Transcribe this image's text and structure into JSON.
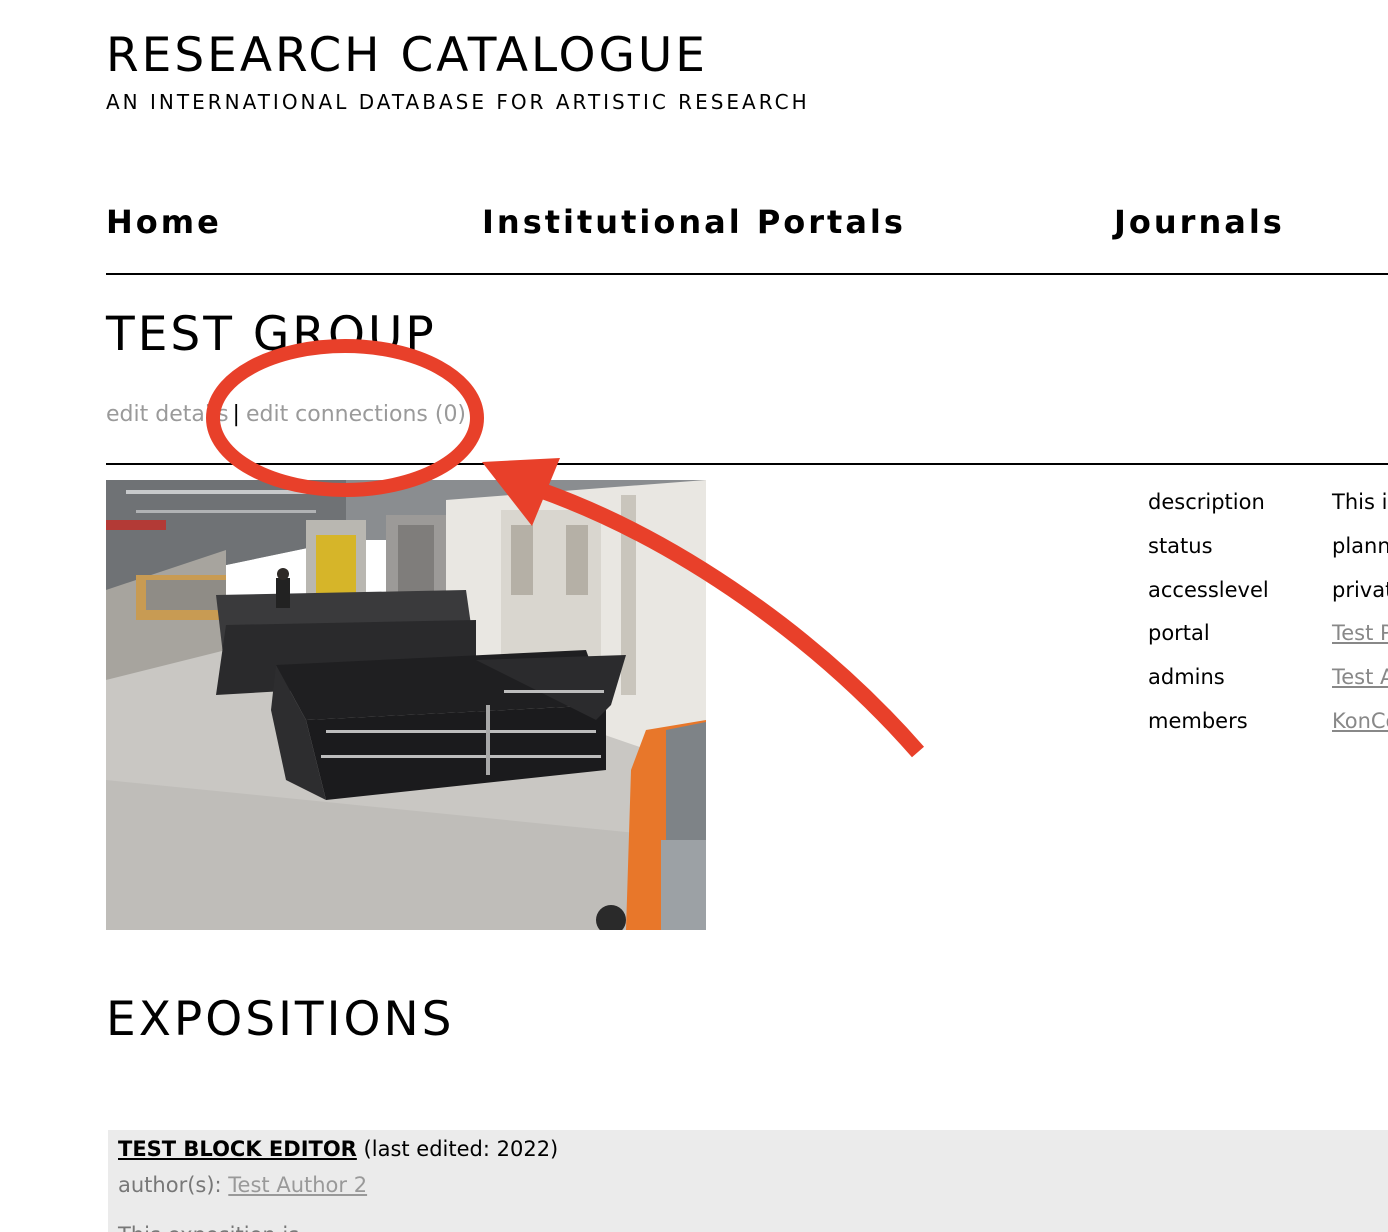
{
  "header": {
    "site_title": "RESEARCH CATALOGUE",
    "site_subtitle": "AN INTERNATIONAL DATABASE FOR ARTISTIC RESEARCH"
  },
  "nav": {
    "items": [
      {
        "label": "Home"
      },
      {
        "label": "Institutional Portals"
      },
      {
        "label": "Journals"
      }
    ]
  },
  "group": {
    "title": "TEST GROUP",
    "edit_details_label": "edit details",
    "separator": "|",
    "edit_connections_label": "edit connections (0)"
  },
  "details": {
    "rows": [
      {
        "key": "description",
        "value": "This is"
      },
      {
        "key": "status",
        "value": "planned"
      },
      {
        "key": "accesslevel",
        "value": "private"
      },
      {
        "key": "portal",
        "value": "Test Portal"
      },
      {
        "key": "admins",
        "value": "Test Author"
      },
      {
        "key": "members",
        "value": "KonCon"
      }
    ]
  },
  "expositions": {
    "heading": "EXPOSITIONS",
    "items": [
      {
        "title": "TEST BLOCK EDITOR",
        "meta": "(last edited: 2022)",
        "author_prefix": "author(s):",
        "author": "Test Author 2",
        "abstract_start": "This exposition is"
      }
    ]
  },
  "colors": {
    "annotation_red": "#e8402a",
    "link_gray": "#9a9a9a",
    "card_bg": "#ebebeb"
  }
}
